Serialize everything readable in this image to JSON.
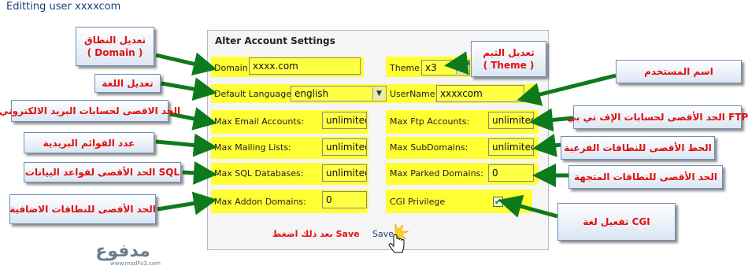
{
  "page": {
    "title": "Editting user xxxxcom"
  },
  "panel": {
    "title": "Alter Account Settings",
    "domain_label": "Domain",
    "domain_value": "xxxx.com",
    "theme_label": "Theme",
    "theme_value": "x3",
    "language_label": "Default Language",
    "language_value": "english",
    "username_label": "UserName",
    "username_value": "xxxxcom",
    "email_label": "Max Email Accounts:",
    "email_value": "unlimited",
    "ftp_label": "Max Ftp Accounts:",
    "ftp_value": "unlimited",
    "mailing_label": "Max Mailing Lists:",
    "mailing_value": "unlimited",
    "subdomains_label": "Max SubDomains:",
    "subdomains_value": "unlimited",
    "sql_label": "Max SQL Databases:",
    "sql_value": "unlimited",
    "parked_label": "Max Parked Domains:",
    "parked_value": "0",
    "addon_label": "Max Addon Domains:",
    "addon_value": "0",
    "cgi_label": "CGI Privilege",
    "cgi_checked": true,
    "save_label": "Save"
  },
  "annotations": {
    "domain_line1": "تعديل النطاق",
    "domain_line2": "( Domain )",
    "language": "تعديل اللغة",
    "email": "الحد الاقصى لحسابات البريد الالكتروني",
    "mailing": "عدد القوائم البريدية",
    "sql": "الحد الأقصى لقواعد البيانات SQL",
    "addon": "الحد الأقصى للنطاقات الاضافية",
    "theme_line1": "تعديل الثيم",
    "theme_line2": "( Theme )",
    "username": "اسم المستخدم",
    "ftp": "الحد الأقصى لحسابات الإف تي بي FTP",
    "subdomains": "الحط الأقصى للنطاقات الفرعية",
    "parked": "الحد الأقصى للنطاقات المتجهة",
    "cgi": "تفعيل لغة CGI",
    "save_note": "بعد ذلك اضغط Save"
  },
  "logo": {
    "text": "مدفوع",
    "url_text": "www.madFo3.com"
  },
  "colors": {
    "highlight": "#ffff33",
    "arrow": "#0d7a1c",
    "callout_text": "#e01010",
    "title_text": "#1a3f78"
  }
}
